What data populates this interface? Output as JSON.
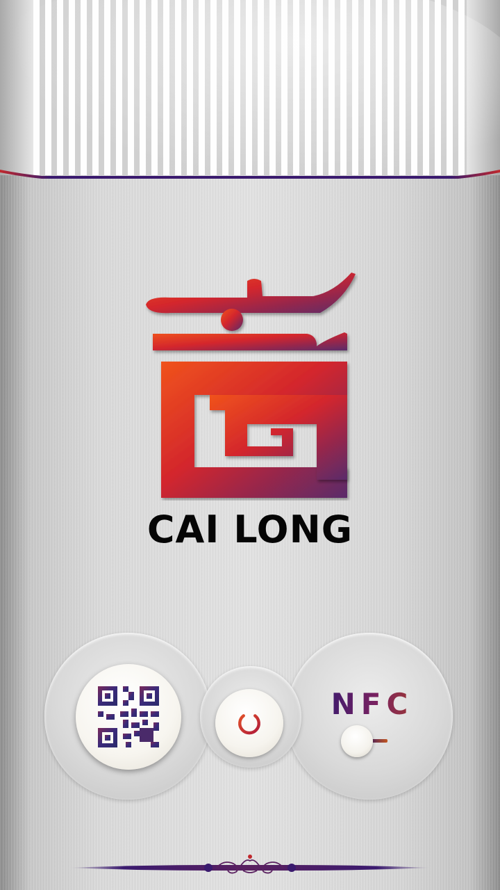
{
  "brand": {
    "name": "CAI LONG"
  },
  "controls": {
    "qr_icon": "qr-code-icon",
    "power_icon": "power-icon",
    "nfc_label": "NFC",
    "nfc_toggle_state": "off"
  },
  "colors": {
    "logo_gradient_start": "#f0531c",
    "logo_gradient_end": "#5a2a6a",
    "accent_purple": "#3a1a6e",
    "accent_red": "#c0282d"
  }
}
